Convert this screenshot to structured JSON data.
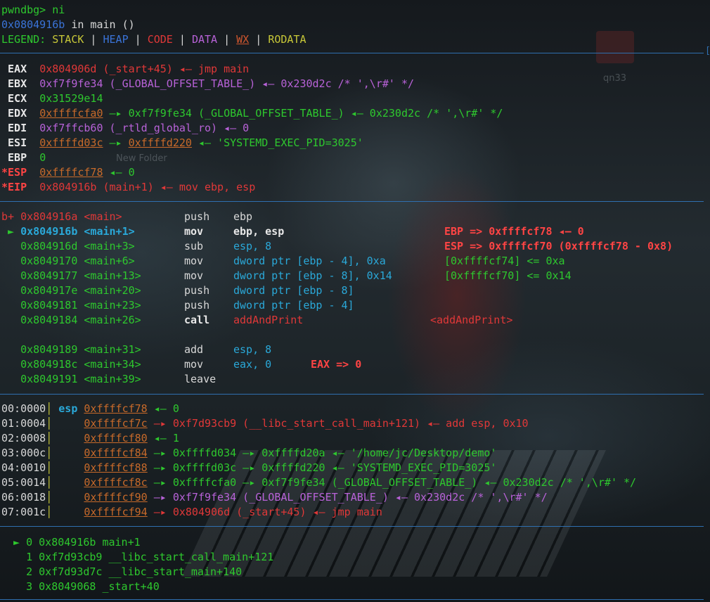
{
  "prompt": "pwndbg> ni",
  "location": {
    "addr": "0x0804916b",
    "text": " in main ()"
  },
  "legend": {
    "prefix": "LEGEND: ",
    "stack": "STACK",
    "heap": "HEAP",
    "code": "CODE",
    "data": "DATA",
    "wx": "WX",
    "rodata": "RODATA",
    "sep": " | "
  },
  "registers": [
    {
      "name": " EAX",
      "value": "0x804906d",
      "rest": " (_start+45) ◂— jmp main"
    },
    {
      "name": " EBX",
      "value": "0xf7f9fe34",
      "rest": " (_GLOBAL_OFFSET_TABLE_) ◂— 0x230d2c /* ',\\r#' */"
    },
    {
      "name": " ECX",
      "value": "0x31529e14",
      "rest": ""
    },
    {
      "name": " EDX",
      "value": "0xffffcfa0",
      "rest": " —▸ 0xf7f9fe34 (_GLOBAL_OFFSET_TABLE_) ◂— 0x230d2c /* ',\\r#' */"
    },
    {
      "name": " EDI",
      "value": "0xf7ffcb60",
      "rest": " (_rtld_global_ro) ◂— 0"
    },
    {
      "name": " ESI",
      "value": "0xffffd03c",
      "mid": " —▸ ",
      "value2": "0xffffd220",
      "rest": " ◂— 'SYSTEMD_EXEC_PID=3025'"
    },
    {
      "name": " EBP",
      "value": "0",
      "rest": ""
    },
    {
      "name": "*ESP",
      "value": "0xffffcf78",
      "rest": " ◂— 0"
    },
    {
      "name": "*EIP",
      "value": "0x804916b",
      "rest": " (main+1) ◂— mov ebp, esp"
    }
  ],
  "disasm": [
    {
      "marker": "b+",
      "addr": " 0x804916a",
      "sym": " <main>    ",
      "op": "push",
      "args": "ebp",
      "note": ""
    },
    {
      "marker": " ►",
      "addr": " 0x804916b",
      "sym": " <main+1>  ",
      "op": "mov",
      "args": "ebp, esp",
      "note": "EBP => 0xffffcf78 ◂— 0"
    },
    {
      "marker": "  ",
      "addr": " 0x804916d",
      "sym": " <main+3>  ",
      "op": "sub",
      "args": "esp, 8",
      "note": "ESP => 0xffffcf70 (0xffffcf78 - 0x8)"
    },
    {
      "marker": "  ",
      "addr": " 0x8049170",
      "sym": " <main+6>  ",
      "op": "mov",
      "args": "dword ptr [ebp - 4], 0xa",
      "note": "[0xffffcf74] <= 0xa"
    },
    {
      "marker": "  ",
      "addr": " 0x8049177",
      "sym": " <main+13> ",
      "op": "mov",
      "args": "dword ptr [ebp - 8], 0x14",
      "note": "[0xffffcf70] <= 0x14"
    },
    {
      "marker": "  ",
      "addr": " 0x804917e",
      "sym": " <main+20> ",
      "op": "push",
      "args": "dword ptr [ebp - 8]",
      "note": ""
    },
    {
      "marker": "  ",
      "addr": " 0x8049181",
      "sym": " <main+23> ",
      "op": "push",
      "args": "dword ptr [ebp - 4]",
      "note": ""
    },
    {
      "marker": "  ",
      "addr": " 0x8049184",
      "sym": " <main+26> ",
      "op": "call",
      "args": "addAndPrint",
      "note": "<addAndPrint>"
    },
    {
      "marker": "  ",
      "addr": " 0x8049189",
      "sym": " <main+31> ",
      "op": "add",
      "args": "esp, 8",
      "note": ""
    },
    {
      "marker": "  ",
      "addr": " 0x804918c",
      "sym": " <main+34> ",
      "op": "mov",
      "args": "eax, 0",
      "note": "EAX => 0"
    },
    {
      "marker": "  ",
      "addr": " 0x8049191",
      "sym": " <main+39> ",
      "op": "leave",
      "args": "",
      "note": ""
    }
  ],
  "stack": [
    {
      "idx": "00:0000",
      "reg": "esp",
      "addr": "0xffffcf78",
      "rest": " ◂— 0"
    },
    {
      "idx": "01:0004",
      "reg": "   ",
      "addr": "0xffffcf7c",
      "rest": " —▸ 0xf7d93cb9 (__libc_start_call_main+121) ◂— add esp, 0x10"
    },
    {
      "idx": "02:0008",
      "reg": "   ",
      "addr": "0xffffcf80",
      "rest": " ◂— 1"
    },
    {
      "idx": "03:000c",
      "reg": "   ",
      "addr": "0xffffcf84",
      "rest": " —▸ 0xffffd034 —▸ 0xffffd20a ◂— '/home/jc/Desktop/demo'"
    },
    {
      "idx": "04:0010",
      "reg": "   ",
      "addr": "0xffffcf88",
      "rest": " —▸ 0xffffd03c —▸ 0xffffd220 ◂— 'SYSTEMD_EXEC_PID=3025'"
    },
    {
      "idx": "05:0014",
      "reg": "   ",
      "addr": "0xffffcf8c",
      "rest": " —▸ 0xffffcfa0 —▸ 0xf7f9fe34 (_GLOBAL_OFFSET_TABLE_) ◂— 0x230d2c /* ',\\r#' */"
    },
    {
      "idx": "06:0018",
      "reg": "   ",
      "addr": "0xffffcf90",
      "rest": " —▸ 0xf7f9fe34 (_GLOBAL_OFFSET_TABLE_) ◂— 0x230d2c /* ',\\r#' */"
    },
    {
      "idx": "07:001c",
      "reg": "   ",
      "addr": "0xffffcf94",
      "rest": " —▸ 0x804906d (_start+45) ◂— jmp main"
    }
  ],
  "backtrace": [
    {
      "marker": " ►",
      "text": " 0 0x804916b main+1"
    },
    {
      "marker": "  ",
      "text": " 1 0xf7d93cb9 __libc_start_call_main+121"
    },
    {
      "marker": "  ",
      "text": " 2 0xf7d93d7c __libc_start_main+140"
    },
    {
      "marker": "  ",
      "text": " 3 0x8049068 _start+40"
    }
  ],
  "background": {
    "folder_label": "qn33",
    "folder2_label": "New Folder"
  }
}
